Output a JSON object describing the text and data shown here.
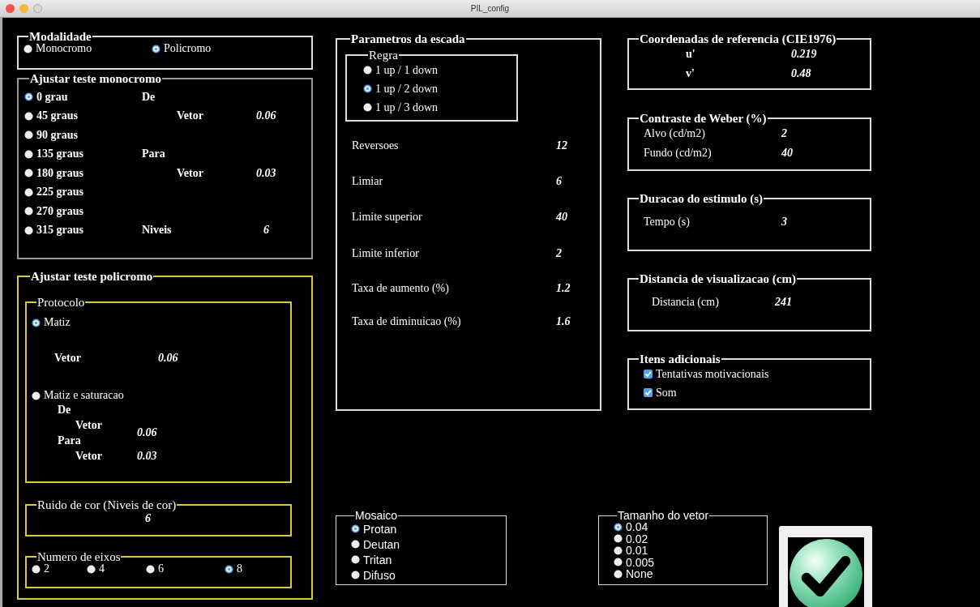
{
  "window": {
    "title": "PIL_config"
  },
  "modalidade": {
    "title": "Modalidade",
    "options": [
      {
        "label": "Monocromo",
        "selected": false
      },
      {
        "label": "Policromo",
        "selected": true
      }
    ]
  },
  "monocromo": {
    "title": "Ajustar teste monocromo",
    "angles": [
      {
        "label": "0 grau",
        "selected": true
      },
      {
        "label": "45 graus",
        "selected": false
      },
      {
        "label": "90 graus",
        "selected": false
      },
      {
        "label": "135 graus",
        "selected": false
      },
      {
        "label": "180 graus",
        "selected": false
      },
      {
        "label": "225 graus",
        "selected": false
      },
      {
        "label": "270 graus",
        "selected": false
      },
      {
        "label": "315 graus",
        "selected": false
      }
    ],
    "de": "De",
    "de_vetor": {
      "label": "Vetor",
      "value": "0.06"
    },
    "para": "Para",
    "para_vetor": {
      "label": "Vetor",
      "value": "0.03"
    },
    "niveis": {
      "label": "Niveis",
      "value": "6"
    }
  },
  "policromo": {
    "title": "Ajustar teste policromo",
    "protocolo": {
      "title": "Protocolo",
      "matiz": {
        "label": "Matiz",
        "selected": true
      },
      "matiz_vetor": {
        "label": "Vetor",
        "value": "0.06"
      },
      "saturacao": {
        "label": "Matiz e saturacao",
        "selected": false
      },
      "de": "De",
      "de_vetor": {
        "label": "Vetor",
        "value": "0.06"
      },
      "para": "Para",
      "para_vetor": {
        "label": "Vetor",
        "value": "0.03"
      }
    },
    "ruido": {
      "title": "Ruido de cor (Niveis de cor)",
      "value": "6"
    },
    "eixos": {
      "title": "Numero de eixos",
      "options": [
        {
          "label": "2",
          "selected": false
        },
        {
          "label": "4",
          "selected": false
        },
        {
          "label": "6",
          "selected": false
        },
        {
          "label": "8",
          "selected": true
        }
      ]
    }
  },
  "escada": {
    "title": "Parametros da escada",
    "regra": {
      "title": "Regra",
      "options": [
        {
          "label": "1 up / 1 down",
          "selected": false
        },
        {
          "label": "1 up / 2 down",
          "selected": true
        },
        {
          "label": "1 up / 3 down",
          "selected": false
        }
      ]
    },
    "params": [
      {
        "label": "Reversoes",
        "value": "12"
      },
      {
        "label": "Limiar",
        "value": "6"
      },
      {
        "label": "Limite superior",
        "value": "40"
      },
      {
        "label": "Limite inferior",
        "value": "2"
      },
      {
        "label": "Taxa de aumento (%)",
        "value": "1.2"
      },
      {
        "label": "Taxa de diminuicao (%)",
        "value": "1.6"
      }
    ]
  },
  "right_sections": [
    {
      "title": "Coordenadas de referencia (CIE1976)",
      "kind": "pair",
      "rows": [
        {
          "label": "u'",
          "value": "0.219"
        },
        {
          "label": "v'",
          "value": "0.48"
        }
      ]
    },
    {
      "title": "Contraste de Weber (%)",
      "kind": "field",
      "rows": [
        {
          "label": "Alvo (cd/m2)",
          "value": "2"
        },
        {
          "label": "Fundo (cd/m2)",
          "value": "40"
        }
      ]
    },
    {
      "title": "Duracao do estimulo (s)",
      "kind": "field",
      "rows": [
        {
          "label": "Tempo (s)",
          "value": "3"
        }
      ]
    },
    {
      "title": "Distancia de visualizacao (cm)",
      "kind": "field",
      "rows": [
        {
          "label": "Distancia (cm)",
          "value": "241"
        }
      ]
    }
  ],
  "itens": {
    "title": "Itens adicionais",
    "items": [
      {
        "label": "Tentativas motivacionais",
        "checked": true
      },
      {
        "label": "Som",
        "checked": true
      }
    ]
  },
  "mosaico": {
    "title": "Mosaico",
    "options": [
      {
        "label": "Protan",
        "selected": true
      },
      {
        "label": "Deutan",
        "selected": false
      },
      {
        "label": "Tritan",
        "selected": false
      },
      {
        "label": "Difuso",
        "selected": false
      }
    ]
  },
  "tamanho": {
    "title": "Tamanho do vetor",
    "options": [
      {
        "label": "0.04",
        "selected": true
      },
      {
        "label": "0.02",
        "selected": false
      },
      {
        "label": "0.01",
        "selected": false
      },
      {
        "label": "0.005",
        "selected": false
      },
      {
        "label": "None",
        "selected": false
      }
    ]
  }
}
